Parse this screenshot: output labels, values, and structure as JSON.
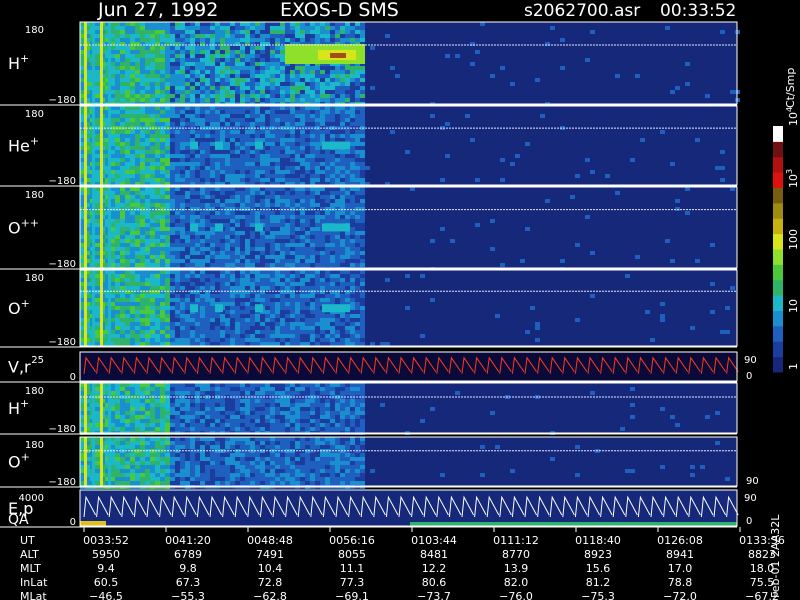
{
  "header": {
    "date": "Jun 27, 1992",
    "mission": "EXOS-D SMS",
    "file": "s2062700.asr",
    "time": "00:33:52"
  },
  "colorbar": {
    "unit_label": "Ct/Smp",
    "tick_labels": [
      "1",
      "10",
      "100",
      "10^3",
      "10^4"
    ],
    "colors": [
      "#16287a",
      "#1d3d9e",
      "#1f5fc0",
      "#1a8fd0",
      "#1ab8c8",
      "#2fb36a",
      "#4cc93a",
      "#8fe02a",
      "#d8e41c",
      "#c8b010",
      "#a08a10",
      "#7a5c10",
      "#e01010",
      "#b01010",
      "#701010",
      "#ffffff"
    ]
  },
  "panels": [
    {
      "label": "H",
      "sup": "+",
      "ymax": "180",
      "ymin": "−180"
    },
    {
      "label": "He",
      "sup": "+",
      "ymax": "180",
      "ymin": "−180"
    },
    {
      "label": "O",
      "sup": "++",
      "ymax": "180",
      "ymin": "−180"
    },
    {
      "label": "O",
      "sup": "+",
      "ymax": "180",
      "ymin": "−180"
    },
    {
      "label": "V,r",
      "sup": "",
      "ymax": "25",
      "ymin": "0",
      "right_top": "90",
      "right_bottom": "0"
    },
    {
      "label": "H",
      "sup": "+",
      "ymax": "180",
      "ymin": "−180"
    },
    {
      "label": "O",
      "sup": "+",
      "ymax": "180",
      "ymin": "−180",
      "right_bottom": "90"
    },
    {
      "label": "E,p",
      "label2": "QA",
      "ymax": "4000",
      "ymin": "0",
      "right_top": "90",
      "right_bottom": "0"
    }
  ],
  "footer": {
    "row_labels": [
      "UT",
      "ALT",
      "MLT",
      "InLat",
      "MLat"
    ],
    "columns": [
      [
        "0033:52",
        "5950",
        "9.4",
        "60.5",
        "−46.5"
      ],
      [
        "0041:20",
        "6789",
        "9.8",
        "67.3",
        "−55.3"
      ],
      [
        "0048:48",
        "7491",
        "10.4",
        "72.8",
        "−62.8"
      ],
      [
        "0056:16",
        "8055",
        "11.1",
        "77.3",
        "−69.1"
      ],
      [
        "0103:44",
        "8481",
        "12.2",
        "80.6",
        "−73.7"
      ],
      [
        "0111:12",
        "8770",
        "13.9",
        "82.0",
        "−76.0"
      ],
      [
        "0118:40",
        "8923",
        "15.6",
        "81.2",
        "−75.3"
      ],
      [
        "0126:08",
        "8941",
        "17.0",
        "78.8",
        "−72.0"
      ],
      [
        "0133:36",
        "8823",
        "18.0",
        "75.5",
        "−67.2"
      ]
    ],
    "side_text": "Feb-01 2AA32L"
  },
  "chart_data": {
    "type": "heatmap",
    "title": "Jun 27, 1992   EXOS-D SMS",
    "x_ticks_ut": [
      "0033:52",
      "0041:20",
      "0048:48",
      "0056:16",
      "0103:44",
      "0111:12",
      "0118:40",
      "0126:08",
      "0133:36"
    ],
    "colorbar_range": [
      1,
      10000
    ],
    "colorbar_scale": "log",
    "panels": [
      "H+ pitch angle",
      "He+ pitch angle",
      "O++ pitch angle",
      "O+ pitch angle",
      "V,r",
      "H+",
      "O+",
      "E,p / QA"
    ],
    "pitch_angle_range": [
      -180,
      180
    ]
  }
}
